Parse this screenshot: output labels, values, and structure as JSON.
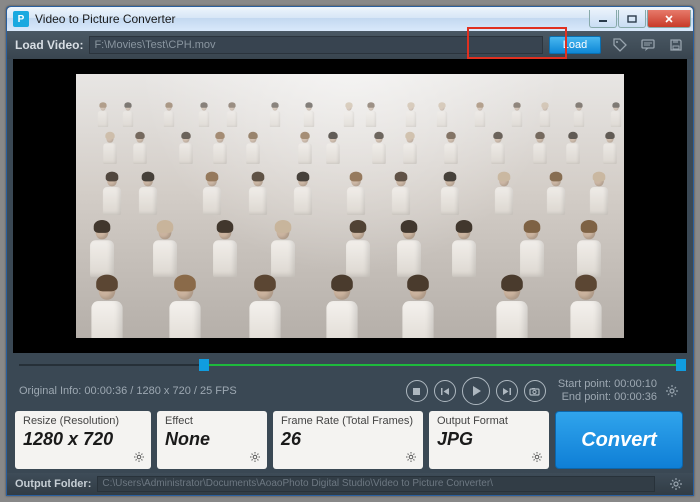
{
  "window": {
    "title": "Video to Picture Converter",
    "icon_letter": "P"
  },
  "toolbar": {
    "load_label": "Load Video:",
    "video_path": "F:\\Movies\\Test\\CPH.mov",
    "load_button": "Load"
  },
  "scrubber": {
    "selection_start_pct": 28,
    "selection_end_pct": 100,
    "playhead_pct": 0
  },
  "info": {
    "original": "Original Info: 00:00:36 / 1280 x 720 / 25 FPS",
    "start_label": "Start point:",
    "start_value": "00:00:10",
    "end_label": "End point:",
    "end_value": "00:00:36"
  },
  "panels": {
    "resize_label": "Resize (Resolution)",
    "resize_value": "1280 x 720",
    "effect_label": "Effect",
    "effect_value": "None",
    "framerate_label": "Frame Rate (Total Frames)",
    "framerate_value": "26",
    "format_label": "Output Format",
    "format_value": "JPG",
    "convert_label": "Convert"
  },
  "footer": {
    "label": "Output Folder:",
    "path": "C:\\Users\\Administrator\\Documents\\AoaoPhoto Digital Studio\\Video to Picture Converter\\"
  }
}
